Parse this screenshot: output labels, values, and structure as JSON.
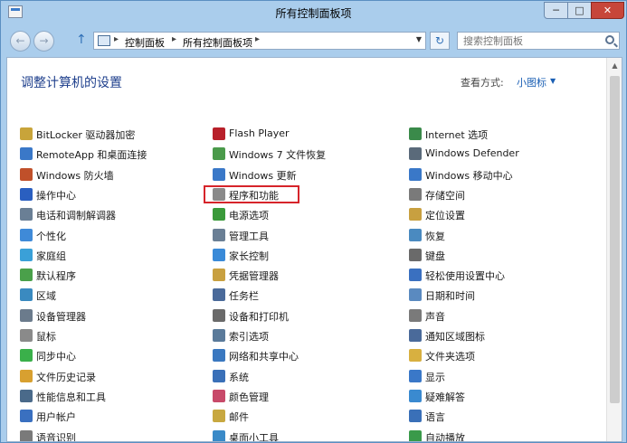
{
  "window": {
    "title": "所有控制面板项"
  },
  "titlebar_buttons": {
    "minimize": "─",
    "maximize": "□",
    "close": "✕"
  },
  "nav": {
    "back": "←",
    "forward": "→",
    "up": "↑",
    "breadcrumb": [
      "控制面板",
      "所有控制面板项"
    ],
    "separator": "▸",
    "dropdown": "▼",
    "refresh": "↻",
    "search_placeholder": "搜索控制面板"
  },
  "content": {
    "heading": "调整计算机的设置",
    "view_by_label": "查看方式:",
    "view_by_value": "小图标",
    "view_by_arrow": "▼"
  },
  "columns": [
    [
      {
        "label": "BitLocker 驱动器加密",
        "icon": "bitlocker-icon",
        "color": "#c8a43a"
      },
      {
        "label": "RemoteApp 和桌面连接",
        "icon": "remoteapp-icon",
        "color": "#3a78c8"
      },
      {
        "label": "Windows 防火墙",
        "icon": "firewall-icon",
        "color": "#c0502a"
      },
      {
        "label": "操作中心",
        "icon": "action-center-flag-icon",
        "color": "#2a5fc0"
      },
      {
        "label": "电话和调制解调器",
        "icon": "phone-modem-icon",
        "color": "#6a7f95"
      },
      {
        "label": "个性化",
        "icon": "personalization-icon",
        "color": "#3f8ad8"
      },
      {
        "label": "家庭组",
        "icon": "homegroup-icon",
        "color": "#3aa0d8"
      },
      {
        "label": "默认程序",
        "icon": "default-programs-icon",
        "color": "#4aa04a"
      },
      {
        "label": "区域",
        "icon": "region-icon",
        "color": "#3a8ac0"
      },
      {
        "label": "设备管理器",
        "icon": "device-manager-icon",
        "color": "#6b7b8c"
      },
      {
        "label": "鼠标",
        "icon": "mouse-icon",
        "color": "#8a8a8a"
      },
      {
        "label": "同步中心",
        "icon": "sync-center-icon",
        "color": "#3ab04a"
      },
      {
        "label": "文件历史记录",
        "icon": "file-history-icon",
        "color": "#d8a030"
      },
      {
        "label": "性能信息和工具",
        "icon": "performance-icon",
        "color": "#4a6a8a"
      },
      {
        "label": "用户帐户",
        "icon": "user-accounts-icon",
        "color": "#3a70c0"
      },
      {
        "label": "语音识别",
        "icon": "speech-recognition-icon",
        "color": "#7a7a7a"
      }
    ],
    [
      {
        "label": "Flash Player",
        "icon": "flash-player-icon",
        "color": "#b8202a"
      },
      {
        "label": "Windows 7 文件恢复",
        "icon": "windows7-recovery-icon",
        "color": "#4a9a4a"
      },
      {
        "label": "Windows 更新",
        "icon": "windows-update-icon",
        "color": "#3a78c8"
      },
      {
        "label": "程序和功能",
        "icon": "programs-features-icon",
        "color": "#8a8a8a"
      },
      {
        "label": "电源选项",
        "icon": "power-options-icon",
        "color": "#3a9a3a"
      },
      {
        "label": "管理工具",
        "icon": "admin-tools-icon",
        "color": "#6a7f95"
      },
      {
        "label": "家长控制",
        "icon": "parental-controls-icon",
        "color": "#3a8ad8"
      },
      {
        "label": "凭据管理器",
        "icon": "credential-manager-icon",
        "color": "#c8a040"
      },
      {
        "label": "任务栏",
        "icon": "taskbar-icon",
        "color": "#4a6a9a"
      },
      {
        "label": "设备和打印机",
        "icon": "devices-printers-icon",
        "color": "#6a6a6a"
      },
      {
        "label": "索引选项",
        "icon": "indexing-options-icon",
        "color": "#5a7a9a"
      },
      {
        "label": "网络和共享中心",
        "icon": "network-sharing-icon",
        "color": "#3a78c0"
      },
      {
        "label": "系统",
        "icon": "system-icon",
        "color": "#3a70b8"
      },
      {
        "label": "颜色管理",
        "icon": "color-management-icon",
        "color": "#c84a6a"
      },
      {
        "label": "邮件",
        "icon": "mail-icon",
        "color": "#c8a840"
      },
      {
        "label": "桌面小工具",
        "icon": "desktop-gadgets-icon",
        "color": "#3a8ac8"
      }
    ],
    [
      {
        "label": "Internet 选项",
        "icon": "internet-options-icon",
        "color": "#3a8a4a"
      },
      {
        "label": "Windows Defender",
        "icon": "windows-defender-icon",
        "color": "#5a6a7a"
      },
      {
        "label": "Windows 移动中心",
        "icon": "mobility-center-icon",
        "color": "#3a78c8"
      },
      {
        "label": "存储空间",
        "icon": "storage-spaces-icon",
        "color": "#7a7a7a"
      },
      {
        "label": "定位设置",
        "icon": "location-settings-icon",
        "color": "#c8a040"
      },
      {
        "label": "恢复",
        "icon": "recovery-icon",
        "color": "#4a8ac0"
      },
      {
        "label": "键盘",
        "icon": "keyboard-icon",
        "color": "#6a6a6a"
      },
      {
        "label": "轻松使用设置中心",
        "icon": "ease-of-access-icon",
        "color": "#3a70c0"
      },
      {
        "label": "日期和时间",
        "icon": "date-time-icon",
        "color": "#5a8ac0"
      },
      {
        "label": "声音",
        "icon": "sound-icon",
        "color": "#7a7a7a"
      },
      {
        "label": "通知区域图标",
        "icon": "notification-area-icon",
        "color": "#4a6a9a"
      },
      {
        "label": "文件夹选项",
        "icon": "folder-options-icon",
        "color": "#d8b040"
      },
      {
        "label": "显示",
        "icon": "display-icon",
        "color": "#3a78c8"
      },
      {
        "label": "疑难解答",
        "icon": "troubleshooting-icon",
        "color": "#3a8ad0"
      },
      {
        "label": "语言",
        "icon": "language-icon",
        "color": "#3a70b8"
      },
      {
        "label": "自动播放",
        "icon": "autoplay-icon",
        "color": "#3a9a4a"
      }
    ]
  ]
}
